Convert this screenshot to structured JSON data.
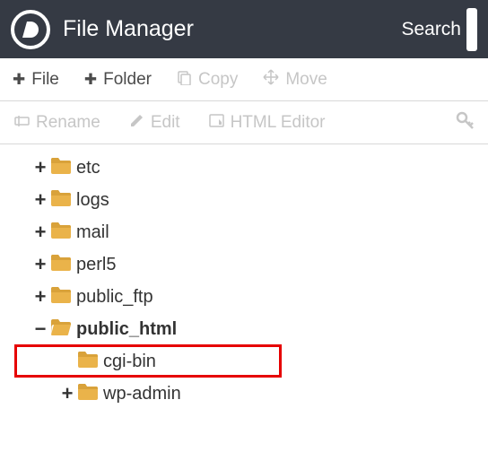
{
  "header": {
    "title": "File Manager",
    "search_label": "Search"
  },
  "toolbar1": {
    "file": "File",
    "folder": "Folder",
    "copy": "Copy",
    "move": "Move"
  },
  "toolbar2": {
    "rename": "Rename",
    "edit": "Edit",
    "html_editor": "HTML Editor"
  },
  "tree": {
    "items": [
      {
        "label": "etc",
        "expanded": false,
        "depth": 0,
        "expandable": true
      },
      {
        "label": "logs",
        "expanded": false,
        "depth": 0,
        "expandable": true
      },
      {
        "label": "mail",
        "expanded": false,
        "depth": 0,
        "expandable": true
      },
      {
        "label": "perl5",
        "expanded": false,
        "depth": 0,
        "expandable": true
      },
      {
        "label": "public_ftp",
        "expanded": false,
        "depth": 0,
        "expandable": true
      },
      {
        "label": "public_html",
        "expanded": true,
        "depth": 0,
        "expandable": true,
        "highlighted": true
      },
      {
        "label": "cgi-bin",
        "expanded": false,
        "depth": 1,
        "expandable": false
      },
      {
        "label": "wp-admin",
        "expanded": false,
        "depth": 1,
        "expandable": true
      }
    ]
  }
}
